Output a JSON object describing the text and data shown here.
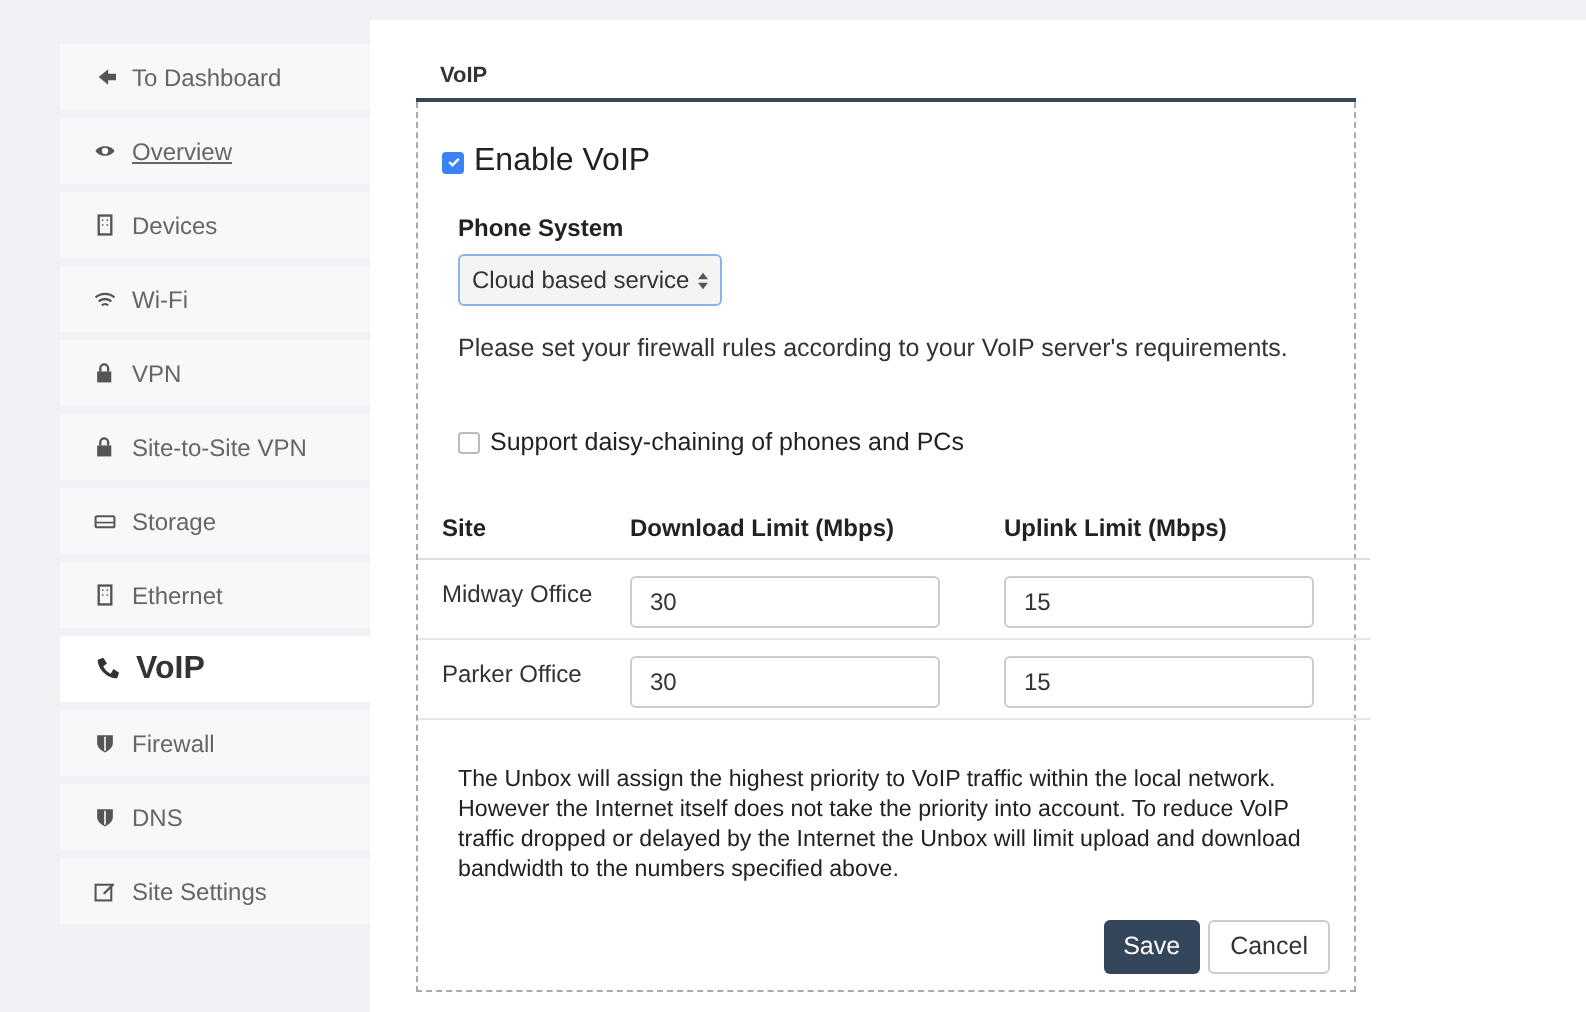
{
  "sidebar": {
    "items": [
      {
        "label": "To Dashboard",
        "kind": "arrow",
        "selected": false,
        "underlined": false
      },
      {
        "label": "Overview",
        "kind": "eye",
        "selected": false,
        "underlined": true
      },
      {
        "label": "Devices",
        "kind": "building",
        "selected": false,
        "underlined": false
      },
      {
        "label": "Wi-Fi",
        "kind": "wifi",
        "selected": false,
        "underlined": false
      },
      {
        "label": "VPN",
        "kind": "lock",
        "selected": false,
        "underlined": false
      },
      {
        "label": "Site-to-Site VPN",
        "kind": "lock",
        "selected": false,
        "underlined": false
      },
      {
        "label": "Storage",
        "kind": "drive",
        "selected": false,
        "underlined": false
      },
      {
        "label": "Ethernet",
        "kind": "building",
        "selected": false,
        "underlined": false
      },
      {
        "label": "VoIP",
        "kind": "phone",
        "selected": true,
        "underlined": false
      },
      {
        "label": "Firewall",
        "kind": "shield",
        "selected": false,
        "underlined": false
      },
      {
        "label": "DNS",
        "kind": "shield",
        "selected": false,
        "underlined": false
      },
      {
        "label": "Site Settings",
        "kind": "edit",
        "selected": false,
        "underlined": false
      }
    ]
  },
  "panel": {
    "title": "VoIP",
    "enable": {
      "label": "Enable VoIP",
      "checked": true
    },
    "phone_system": {
      "label": "Phone System",
      "value": "Cloud based service"
    },
    "firewall_note": "Please set your firewall rules according to your VoIP server's requirements.",
    "daisy_chain": {
      "label": "Support daisy-chaining of phones and PCs",
      "checked": false
    },
    "table": {
      "columns": [
        "Site",
        "Download Limit (Mbps)",
        "Uplink Limit (Mbps)"
      ],
      "rows": [
        {
          "site": "Midway Office",
          "download": "30",
          "uplink": "15"
        },
        {
          "site": "Parker Office",
          "download": "30",
          "uplink": "15"
        }
      ]
    },
    "info": "The Unbox will assign the highest priority to VoIP traffic within the local network. However the Internet itself does not take the priority into account. To reduce VoIP traffic dropped or delayed by the Internet the Unbox will limit upload and download bandwidth to the numbers specified above.",
    "buttons": [
      {
        "label": "Save",
        "kind": "primary"
      },
      {
        "label": "Cancel",
        "kind": "secondary"
      }
    ]
  }
}
